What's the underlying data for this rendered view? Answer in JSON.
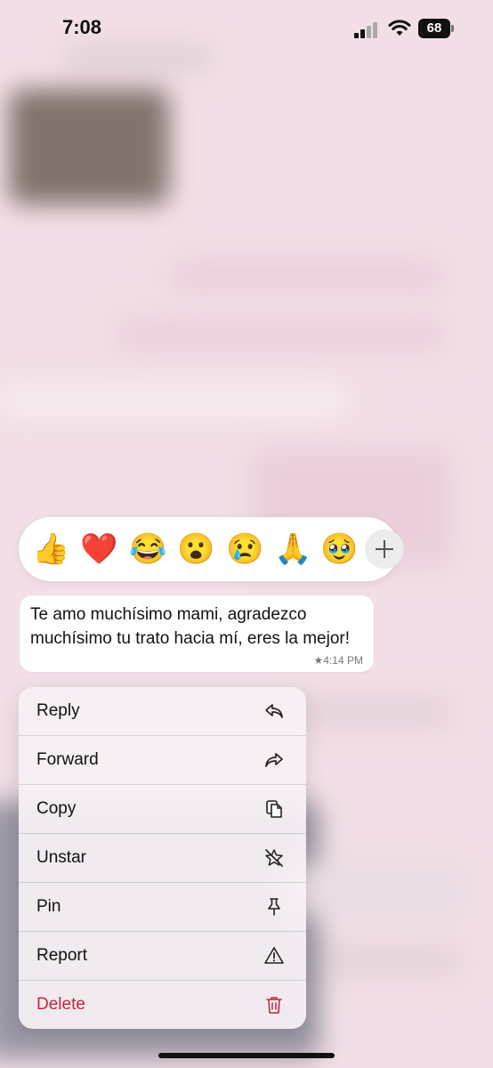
{
  "status_bar": {
    "time": "7:08",
    "battery": "68"
  },
  "reactions": {
    "emojis": [
      {
        "char": "👍",
        "name": "thumbs-up-emoji"
      },
      {
        "char": "❤️",
        "name": "red-heart-emoji"
      },
      {
        "char": "😂",
        "name": "tears-of-joy-emoji"
      },
      {
        "char": "😮",
        "name": "surprised-face-emoji"
      },
      {
        "char": "😢",
        "name": "crying-face-emoji"
      },
      {
        "char": "🙏",
        "name": "folded-hands-emoji"
      },
      {
        "char": "🥹",
        "name": "holding-back-tears-emoji"
      }
    ]
  },
  "message": {
    "text": "Te amo muchísimo mami, agradezco muchísimo tu trato hacia mí, eres la mejor!",
    "star": "★",
    "time": "4:14 PM"
  },
  "menu": {
    "items": [
      {
        "label": "Reply",
        "icon": "reply-icon"
      },
      {
        "label": "Forward",
        "icon": "forward-icon"
      },
      {
        "label": "Copy",
        "icon": "copy-icon"
      },
      {
        "label": "Unstar",
        "icon": "unstar-icon"
      },
      {
        "label": "Pin",
        "icon": "pin-icon"
      },
      {
        "label": "Report",
        "icon": "warning-icon"
      },
      {
        "label": "Delete",
        "icon": "trash-icon"
      }
    ]
  },
  "colors": {
    "danger": "#c0283d",
    "background": "#f3dfe7"
  }
}
